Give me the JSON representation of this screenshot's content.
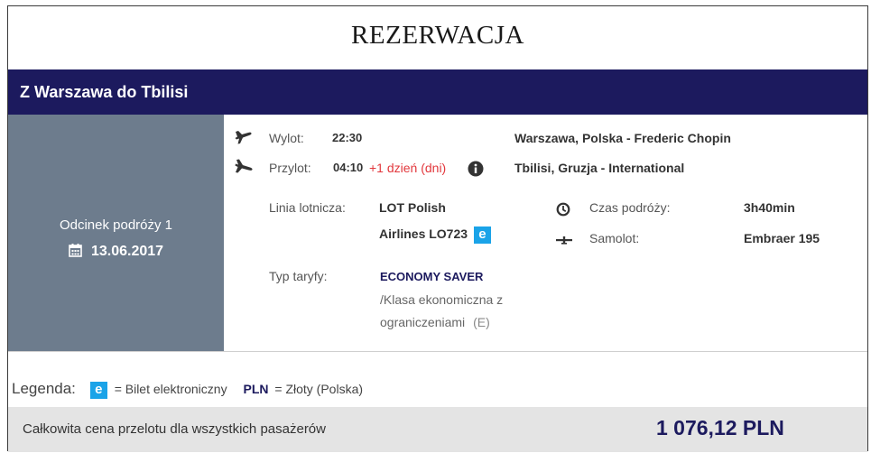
{
  "title": "REZERWACJA",
  "route": "Z Warszawa do Tbilisi",
  "segment": {
    "label": "Odcinek podróży 1",
    "date": "13.06.2017"
  },
  "departure": {
    "label": "Wylot:",
    "time": "22:30",
    "place": "Warszawa, Polska - Frederic Chopin",
    "icon": "plane-takeoff-icon"
  },
  "arrival": {
    "label": "Przylot:",
    "time": "04:10",
    "next_day": "+1 dzień (dni)",
    "place": "Tbilisi, Gruzja - International",
    "icon": "plane-landing-icon"
  },
  "airline": {
    "label": "Linia lotnicza:",
    "line1": "LOT Polish",
    "line2": "Airlines LO723",
    "eticket_badge": "e"
  },
  "duration": {
    "label": "Czas podróży:",
    "value": "3h40min"
  },
  "aircraft": {
    "label": "Samolot:",
    "value": "Embraer 195"
  },
  "fare": {
    "label": "Typ taryfy:",
    "name": "ECONOMY SAVER",
    "class_line1": "/Klasa ekonomiczna z",
    "class_line2": "ograniczeniami",
    "class_code": "(E)"
  },
  "legend": {
    "title": "Legenda:",
    "e_badge": "e",
    "e_text": "= Bilet elektroniczny",
    "currency_code": "PLN",
    "currency_text": "= Złoty (Polska)"
  },
  "total": {
    "label": "Całkowita cena przelotu dla wszystkich pasażerów",
    "price": "1 076,12 PLN"
  },
  "colors": {
    "navy": "#1c1a5e",
    "segment_panel": "#6d7c8d",
    "badge_blue": "#1aa3e8",
    "red": "#e2373c",
    "total_bar": "#e4e4e4"
  }
}
